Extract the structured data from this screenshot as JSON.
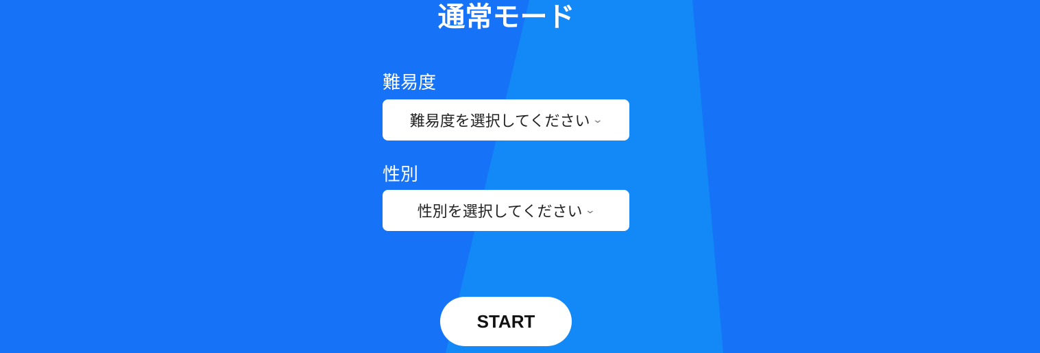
{
  "title": "通常モード",
  "difficulty": {
    "label": "難易度",
    "placeholder": "難易度を選択してください"
  },
  "gender": {
    "label": "性別",
    "placeholder": "性別を選択してください"
  },
  "start_label": "START",
  "colors": {
    "background": "#1672f6",
    "wedge": "#1289f7"
  }
}
